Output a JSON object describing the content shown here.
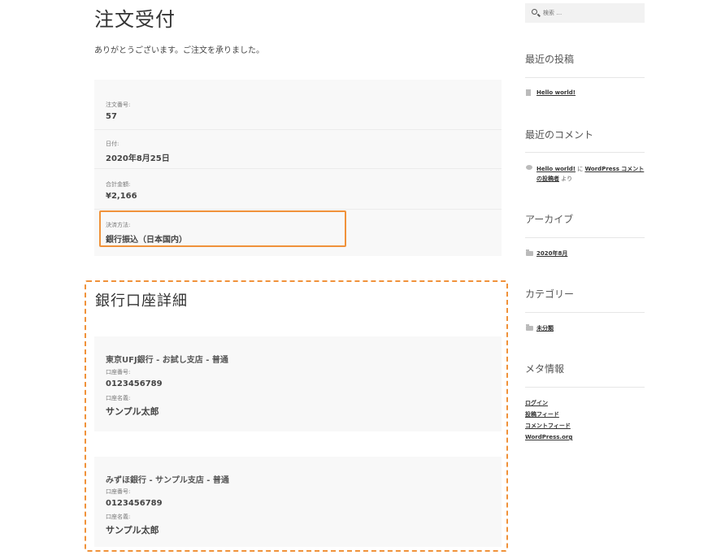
{
  "page": {
    "title": "注文受付",
    "thanks": "ありがとうございます。ご注文を承りました。"
  },
  "order_overview": [
    {
      "label": "注文番号:",
      "value": "57"
    },
    {
      "label": "日付:",
      "value": "2020年8月25日"
    },
    {
      "label": "合計金額:",
      "value": "¥2,166"
    },
    {
      "label": "決済方法:",
      "value": "銀行振込（日本国内）"
    }
  ],
  "bank": {
    "title": "銀行口座詳細",
    "accounts": [
      {
        "name": "東京UFJ銀行 - お試し支店 - 普通",
        "number_label": "口座番号:",
        "number": "0123456789",
        "holder_label": "口座名義:",
        "holder": "サンプル太郎"
      },
      {
        "name": "みずほ銀行 - サンプル支店 - 普通",
        "number_label": "口座番号:",
        "number": "0123456789",
        "holder_label": "口座名義:",
        "holder": "サンプル太郎"
      }
    ]
  },
  "sidebar": {
    "search_placeholder": "検索 …",
    "recent_posts_title": "最近の投稿",
    "recent_post": "Hello world!",
    "recent_comments_title": "最近のコメント",
    "comment_post": "Hello world!",
    "comment_on": "に",
    "comment_author_line1": "WordPress コメント",
    "comment_author_line2": "の投稿者",
    "comment_suffix": "より",
    "archives_title": "アーカイブ",
    "archive_item": "2020年8月",
    "categories_title": "カテゴリー",
    "category_item": "未分類",
    "meta_title": "メタ情報",
    "meta_links": [
      "ログイン",
      "投稿フィード",
      "コメントフィード",
      "WordPress.org"
    ]
  }
}
